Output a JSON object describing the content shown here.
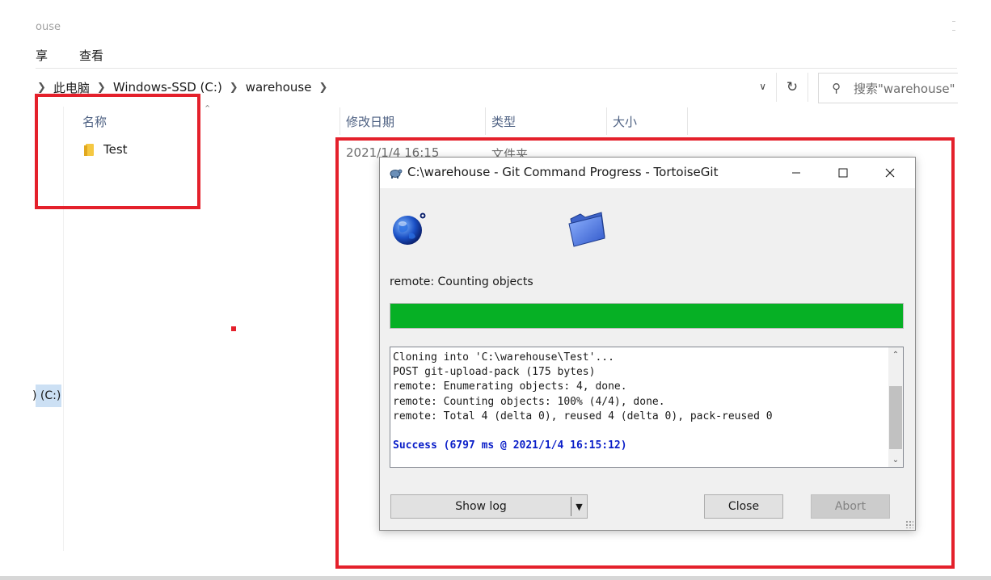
{
  "explorer": {
    "window_title_fragment": "ouse",
    "ribbon_tabs": [
      "享",
      "查看"
    ],
    "address": {
      "crumbs": [
        "此电脑",
        "Windows-SSD (C:)",
        "warehouse"
      ]
    },
    "search": {
      "placeholder": "搜索\"warehouse\""
    },
    "columns": {
      "name": "名称",
      "modified": "修改日期",
      "type": "类型",
      "size": "大小"
    },
    "rows": [
      {
        "name": "Test",
        "modified": "2021/1/4 16:15",
        "type": "文件夹"
      }
    ],
    "nav_drive_label": ") (C:)"
  },
  "dialog": {
    "title": "C:\\warehouse - Git Command Progress - TortoiseGit",
    "status_text": "remote: Counting objects",
    "progress_percent": 100,
    "progress_color": "#06b025",
    "log_lines": [
      "Cloning into 'C:\\warehouse\\Test'...",
      "POST git-upload-pack (175 bytes)",
      "remote: Enumerating objects: 4, done.",
      "remote: Counting objects: 100% (4/4), done.",
      "remote: Total 4 (delta 0), reused 4 (delta 0), pack-reused 0"
    ],
    "success_line": "Success (6797 ms @ 2021/1/4 16:15:12)",
    "buttons": {
      "show_log": "Show log",
      "close": "Close",
      "abort": "Abort"
    }
  },
  "highlight_color": "#e4202b"
}
